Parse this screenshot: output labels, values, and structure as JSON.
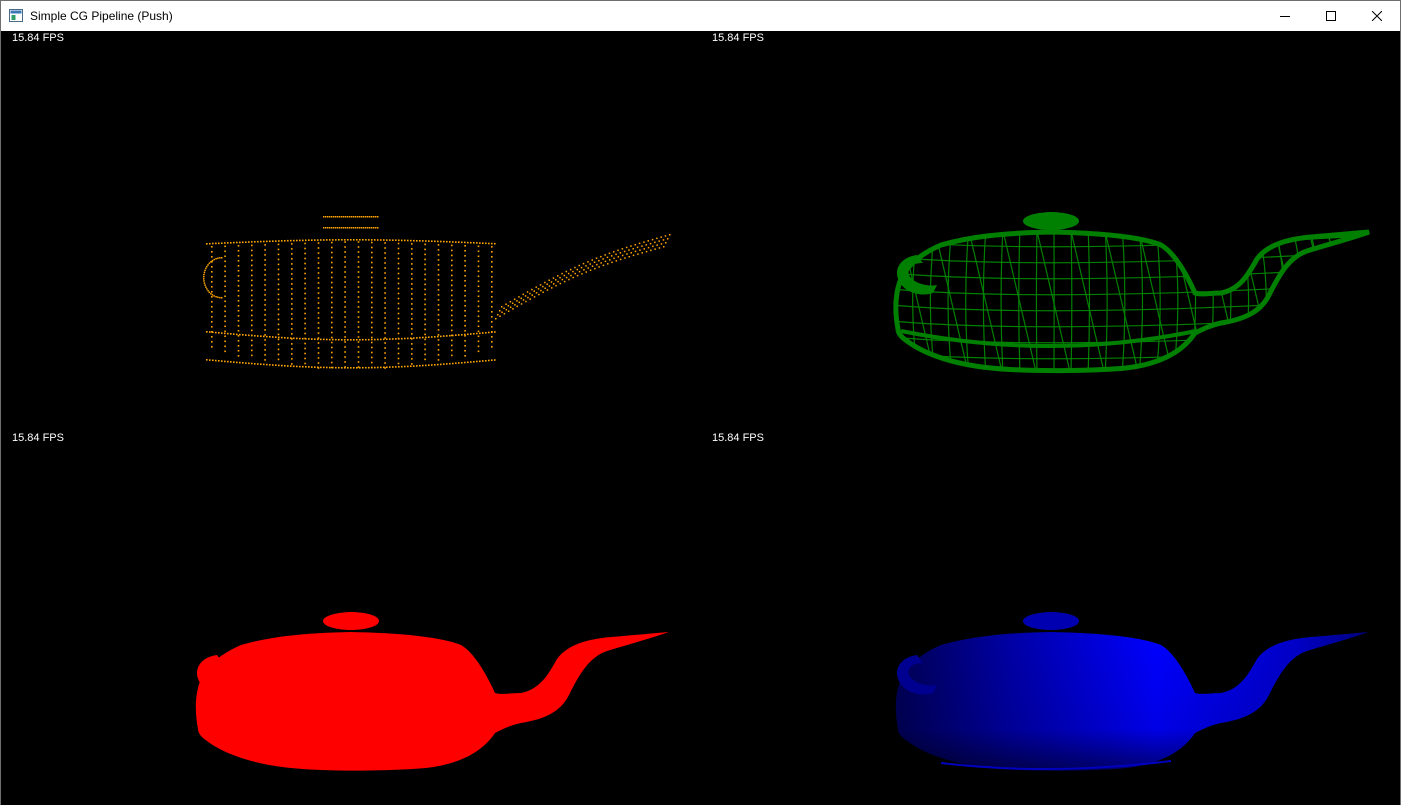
{
  "window": {
    "title": "Simple CG Pipeline (Push)",
    "icons": {
      "app": "app-window-icon",
      "minimize": "minimize-icon",
      "maximize": "maximize-icon",
      "close": "close-icon"
    }
  },
  "viewports": [
    {
      "fps": "15.84 FPS",
      "render_mode": "points",
      "color": "#ffa500"
    },
    {
      "fps": "15.84 FPS",
      "render_mode": "wireframe",
      "color": "#008000"
    },
    {
      "fps": "15.84 FPS",
      "render_mode": "flat-fill",
      "color": "#ff0000"
    },
    {
      "fps": "15.84 FPS",
      "render_mode": "shaded",
      "color": "#0000ff"
    }
  ]
}
